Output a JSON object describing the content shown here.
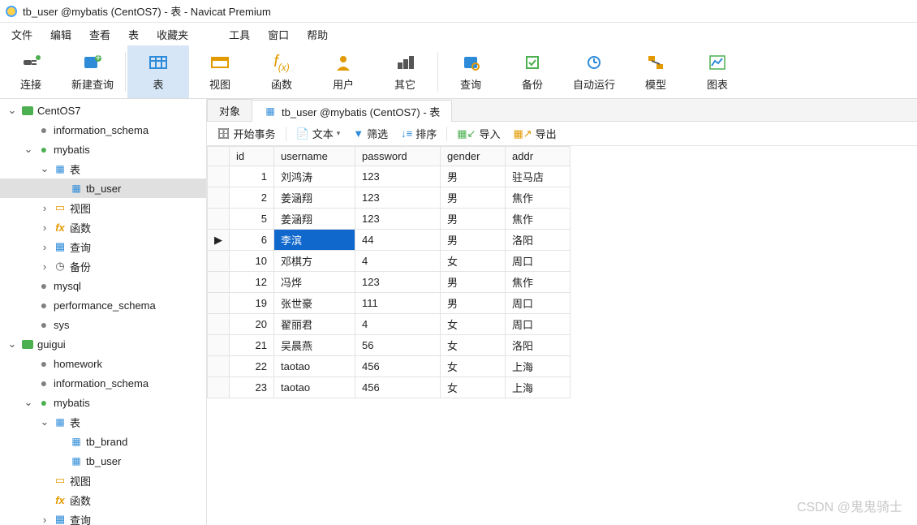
{
  "title": "tb_user @mybatis (CentOS7) - 表 - Navicat Premium",
  "menu": [
    "文件",
    "编辑",
    "查看",
    "表",
    "收藏夹",
    "工具",
    "窗口",
    "帮助"
  ],
  "toolbar": [
    {
      "label": "连接",
      "icon": "plug"
    },
    {
      "label": "新建查询",
      "icon": "newquery"
    },
    {
      "label": "表",
      "icon": "table",
      "active": true
    },
    {
      "label": "视图",
      "icon": "view"
    },
    {
      "label": "函数",
      "icon": "fx"
    },
    {
      "label": "用户",
      "icon": "user"
    },
    {
      "label": "其它",
      "icon": "other"
    },
    {
      "label": "查询",
      "icon": "query"
    },
    {
      "label": "备份",
      "icon": "backup"
    },
    {
      "label": "自动运行",
      "icon": "auto"
    },
    {
      "label": "模型",
      "icon": "model"
    },
    {
      "label": "图表",
      "icon": "chart"
    }
  ],
  "tree": [
    {
      "d": 0,
      "tw": "v",
      "ico": "conn",
      "label": "CentOS7"
    },
    {
      "d": 1,
      "tw": "",
      "ico": "db",
      "label": "information_schema"
    },
    {
      "d": 1,
      "tw": "v",
      "ico": "dbg",
      "label": "mybatis"
    },
    {
      "d": 2,
      "tw": "v",
      "ico": "tbl",
      "label": "表"
    },
    {
      "d": 3,
      "tw": "",
      "ico": "tbl",
      "label": "tb_user",
      "sel": true
    },
    {
      "d": 2,
      "tw": ">",
      "ico": "view",
      "label": "视图"
    },
    {
      "d": 2,
      "tw": ">",
      "ico": "fx",
      "label": "函数"
    },
    {
      "d": 2,
      "tw": ">",
      "ico": "qry",
      "label": "查询"
    },
    {
      "d": 2,
      "tw": ">",
      "ico": "bak",
      "label": "备份"
    },
    {
      "d": 1,
      "tw": "",
      "ico": "db",
      "label": "mysql"
    },
    {
      "d": 1,
      "tw": "",
      "ico": "db",
      "label": "performance_schema"
    },
    {
      "d": 1,
      "tw": "",
      "ico": "db",
      "label": "sys"
    },
    {
      "d": 0,
      "tw": "v",
      "ico": "conn",
      "label": "guigui"
    },
    {
      "d": 1,
      "tw": "",
      "ico": "db",
      "label": "homework"
    },
    {
      "d": 1,
      "tw": "",
      "ico": "db",
      "label": "information_schema"
    },
    {
      "d": 1,
      "tw": "v",
      "ico": "dbg",
      "label": "mybatis"
    },
    {
      "d": 2,
      "tw": "v",
      "ico": "tbl",
      "label": "表"
    },
    {
      "d": 3,
      "tw": "",
      "ico": "tbl",
      "label": "tb_brand"
    },
    {
      "d": 3,
      "tw": "",
      "ico": "tbl",
      "label": "tb_user"
    },
    {
      "d": 2,
      "tw": "",
      "ico": "view",
      "label": "视图"
    },
    {
      "d": 2,
      "tw": "",
      "ico": "fx",
      "label": "函数"
    },
    {
      "d": 2,
      "tw": ">",
      "ico": "qry",
      "label": "查询"
    }
  ],
  "tabs": {
    "obj": "对象",
    "data_label": "tb_user @mybatis (CentOS7) - 表"
  },
  "sub": [
    "开始事务",
    "文本",
    "筛选",
    "排序",
    "导入",
    "导出"
  ],
  "cols": [
    "id",
    "username",
    "password",
    "gender",
    "addr"
  ],
  "rows": [
    {
      "id": 1,
      "username": "刘鸿涛",
      "password": "123",
      "gender": "男",
      "addr": "驻马店"
    },
    {
      "id": 2,
      "username": "姜涵翔",
      "password": "123",
      "gender": "男",
      "addr": "焦作"
    },
    {
      "id": 5,
      "username": "姜涵翔",
      "password": "123",
      "gender": "男",
      "addr": "焦作"
    },
    {
      "id": 6,
      "username": "李滨",
      "password": "44",
      "gender": "男",
      "addr": "洛阳",
      "sel": true
    },
    {
      "id": 10,
      "username": "邓棋方",
      "password": "4",
      "gender": "女",
      "addr": "周口"
    },
    {
      "id": 12,
      "username": "冯烨",
      "password": "123",
      "gender": "男",
      "addr": "焦作"
    },
    {
      "id": 19,
      "username": "张世豪",
      "password": "111",
      "gender": "男",
      "addr": "周口"
    },
    {
      "id": 20,
      "username": "翟丽君",
      "password": "4",
      "gender": "女",
      "addr": "周口"
    },
    {
      "id": 21,
      "username": "吴晨燕",
      "password": "56",
      "gender": "女",
      "addr": "洛阳"
    },
    {
      "id": 22,
      "username": "taotao",
      "password": "456",
      "gender": "女",
      "addr": "上海"
    },
    {
      "id": 23,
      "username": "taotao",
      "password": "456",
      "gender": "女",
      "addr": "上海"
    }
  ],
  "watermark": "CSDN @鬼鬼骑士"
}
